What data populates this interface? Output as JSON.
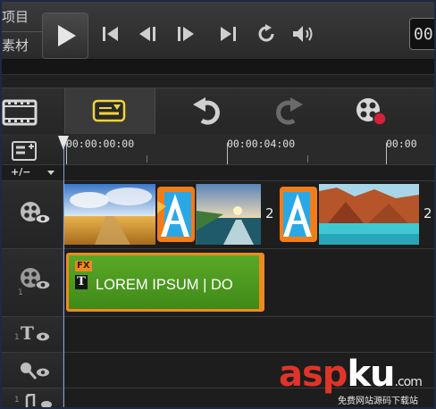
{
  "modes": {
    "project": "项目",
    "clip": "素材"
  },
  "timecode": "00",
  "ruler": {
    "tc0": "00:00:00:00",
    "tc1": "00:00:04:00",
    "tc2": "00:00"
  },
  "tracks": {
    "add_remove": "+/−"
  },
  "video_track": {
    "caption_2": "2",
    "caption_4": "2"
  },
  "overlay_track": {
    "fx_badge": "FX",
    "title_glyph": "T",
    "title_text": "LOREM IPSUM | DO"
  },
  "track_numbers": {
    "title": "1",
    "voice": "1"
  },
  "watermark": {
    "asp": "asp",
    "ku": "ku",
    "dot_com": ".com",
    "sub": "免费网站源码下载站"
  },
  "colors": {
    "accent_yellow": "#f2d43b",
    "title_clip_green": "#4b9a1e",
    "clip_border_orange": "#f08a1c",
    "transition_orange": "#f07d1a",
    "transition_blue": "#2aa8e6"
  }
}
